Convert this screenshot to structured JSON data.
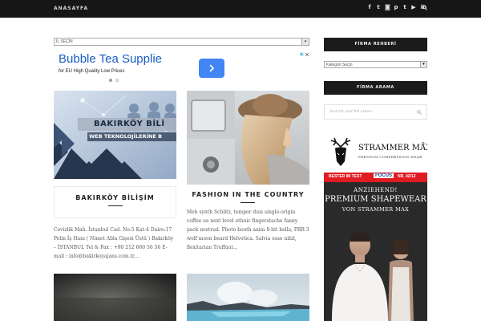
{
  "nav": {
    "home_label": "ANASAYFA",
    "social_icons": [
      "facebook-icon",
      "twitter-icon",
      "instagram-icon",
      "pinterest-icon",
      "tumblr-icon",
      "youtube-icon",
      "linkedin-icon"
    ],
    "social_glyphs": [
      "f",
      "t",
      "◙",
      "p",
      "t",
      "▶",
      "in"
    ]
  },
  "main": {
    "select_value": "İL SEÇİN",
    "ad": {
      "headline": "Bubble Tea Supplie",
      "subline": "for EU High Quality Low Prices",
      "active_dot": 0
    },
    "cards": [
      {
        "image_text_1": "BAKIRKÖY BİLİ",
        "image_text_2": "WEB TEKNOLOJİLERİNE B",
        "title": "BAKIRKÖY BİLİŞİM",
        "excerpt": "Cevizlik Mah. İstanbul Cad. No:5 Kat:4 Daire:17 Pelin İş Hanı ( Nimet Abla Gişesi Üstü ) Bakırköy – İSTANBUL Tel & Fax : +90 212 660 56 56 E-mail : info@bakirkoyajans.com.tr,..."
      },
      {
        "title": "FASHION IN THE COUNTRY",
        "excerpt": "Meh synth Schlitz, tempor duis single-origin coffee ea next level ethnic fingerstache fanny pack nostrud. Photo booth anim 8-bit hella, PBR 3 wolf moon beard Helvetica. Salvia esse nihil, flexitarian Truffaut..."
      }
    ]
  },
  "sidebar": {
    "directory_title": "FİRMA REHBERİ",
    "category_select": "Kategori Seçin",
    "search_title": "FİRMA ARAMA",
    "search_placeholder": "Search and hit enter...",
    "ad": {
      "brand": "STRAMMER MAX",
      "registered": "®",
      "brand_sub": "PREMIUM COMPRESSION WEAR",
      "strip_left": "BESTER IM TEST",
      "strip_mid": "FOCUS",
      "strip_right": "NR. 42/12",
      "line1": "ANZIEHEND!",
      "line2": "PREMIUM SHAPEWEAR",
      "line3": "VON STRAMMER MAX",
      "line3_reg": "®"
    }
  },
  "colors": {
    "topbar": "#161616",
    "widget_header": "#1b1b1b",
    "ad_link": "#1a5bc4",
    "ad_button": "#4285f4",
    "ad_strip": "#e11b22"
  }
}
